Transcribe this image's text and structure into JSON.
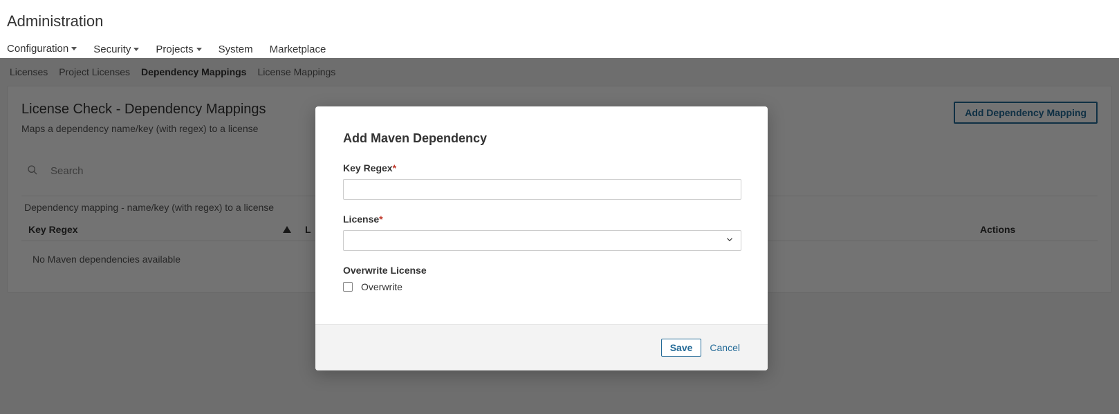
{
  "header": {
    "title": "Administration"
  },
  "main_nav": {
    "items": [
      {
        "label": "Configuration",
        "has_caret": true,
        "active": true
      },
      {
        "label": "Security",
        "has_caret": true,
        "active": false
      },
      {
        "label": "Projects",
        "has_caret": true,
        "active": false
      },
      {
        "label": "System",
        "has_caret": false,
        "active": false
      },
      {
        "label": "Marketplace",
        "has_caret": false,
        "active": false
      }
    ]
  },
  "sub_nav": {
    "items": [
      {
        "label": "Licenses",
        "active": false
      },
      {
        "label": "Project Licenses",
        "active": false
      },
      {
        "label": "Dependency Mappings",
        "active": true
      },
      {
        "label": "License Mappings",
        "active": false
      }
    ]
  },
  "panel": {
    "title": "License Check - Dependency Mappings",
    "description": "Maps a dependency name/key (with regex) to a license",
    "add_button": "Add Dependency Mapping",
    "search_placeholder": "Search",
    "table_caption": "Dependency mapping - name/key (with regex) to a license",
    "columns": {
      "key": "Key Regex",
      "license_head": "L",
      "actions": "Actions"
    },
    "empty_message": "No Maven dependencies available"
  },
  "modal": {
    "title": "Add Maven Dependency",
    "fields": {
      "key_regex": {
        "label": "Key Regex",
        "required": true,
        "value": ""
      },
      "license": {
        "label": "License",
        "required": true,
        "value": ""
      },
      "overwrite": {
        "label": "Overwrite License",
        "checkbox_label": "Overwrite",
        "checked": false
      }
    },
    "actions": {
      "save": "Save",
      "cancel": "Cancel"
    }
  }
}
